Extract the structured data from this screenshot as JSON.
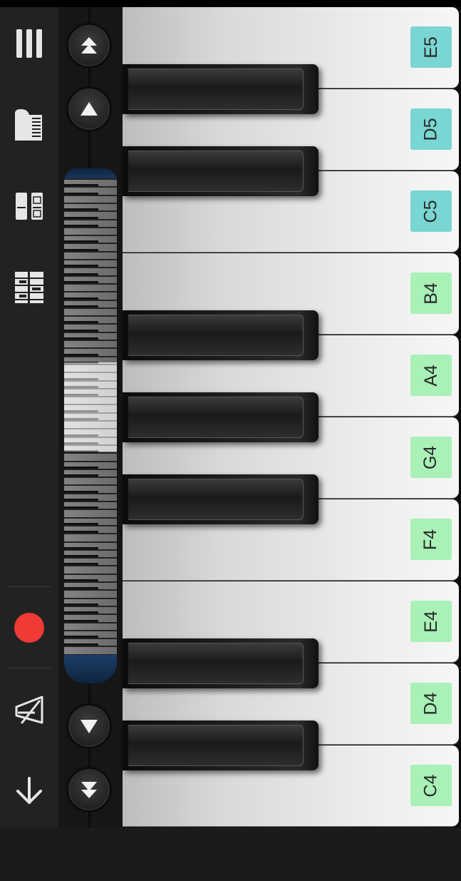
{
  "keys": [
    {
      "note": "E5",
      "tint": "teal"
    },
    {
      "note": "D5",
      "tint": "teal"
    },
    {
      "note": "C5",
      "tint": "teal"
    },
    {
      "note": "B4",
      "tint": "green"
    },
    {
      "note": "A4",
      "tint": "green"
    },
    {
      "note": "G4",
      "tint": "green"
    },
    {
      "note": "F4",
      "tint": "green"
    },
    {
      "note": "E4",
      "tint": "green"
    },
    {
      "note": "D4",
      "tint": "green"
    },
    {
      "note": "C4",
      "tint": "green"
    }
  ],
  "colors": {
    "record": "#f03a35",
    "label_green": "#a9f1b6",
    "label_teal": "#79d6d2"
  },
  "toolbar_icons": [
    "menu-icon",
    "grand-piano-icon",
    "dual-keyboard-icon",
    "chords-icon",
    "record-icon",
    "metronome-icon",
    "download-icon"
  ],
  "navigation_icons": [
    "octave-up-icon",
    "key-up-icon",
    "key-down-icon",
    "octave-down-icon"
  ]
}
